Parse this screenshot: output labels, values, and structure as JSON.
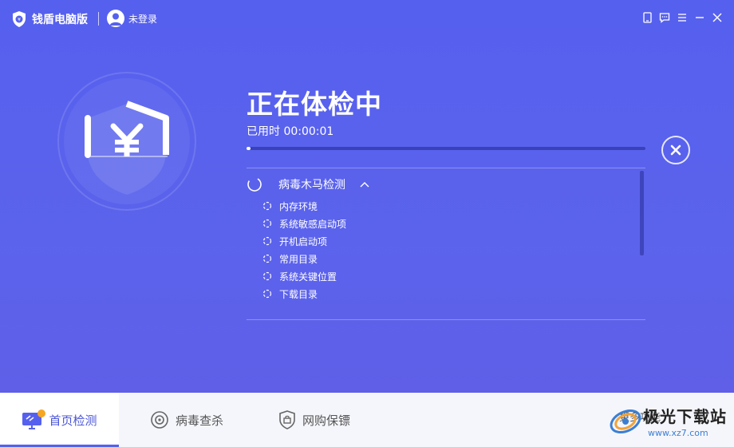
{
  "titlebar": {
    "app_name": "钱盾电脑版",
    "user_label": "未登录"
  },
  "status": {
    "title": "正在体检中",
    "elapsed_label": "已用时",
    "elapsed_time": "00:00:01",
    "progress": 0.01
  },
  "scan_section": {
    "title": "病毒木马检测",
    "items": [
      "内存环境",
      "系统敏感启动项",
      "开机启动项",
      "常用目录",
      "系统关键位置",
      "下载目录"
    ]
  },
  "bottom_nav": {
    "tabs": [
      {
        "label": "首页检测",
        "icon": "monitor-icon",
        "active": true
      },
      {
        "label": "病毒查杀",
        "icon": "target-icon"
      },
      {
        "label": "网购保镖",
        "icon": "bag-shield-icon"
      }
    ],
    "more_label": "更多功能"
  },
  "watermark": {
    "name": "极光下载站",
    "url": "www.xz7.com"
  },
  "colors": {
    "background": "#5660ee",
    "nav_background": "#f5f6fb",
    "accent": "#4a55d8"
  }
}
